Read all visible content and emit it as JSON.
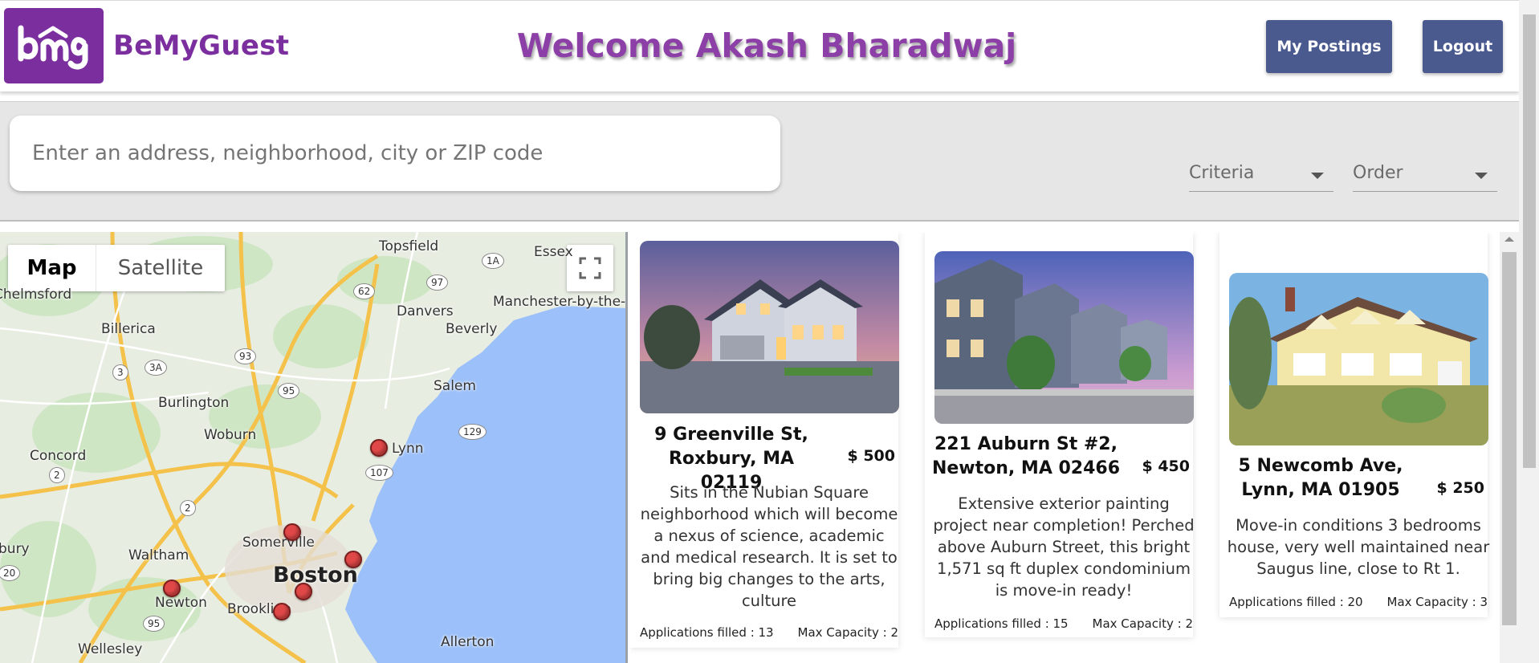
{
  "header": {
    "brand": "BeMyGuest",
    "welcome": "Welcome Akash Bharadwaj",
    "my_postings_label": "My Postings",
    "logout_label": "Logout",
    "brand_color": "#7b2f9f",
    "button_color": "#4a5a8f"
  },
  "search": {
    "placeholder": "Enter an address, neighborhood, city or ZIP code",
    "criteria_label": "Criteria",
    "order_label": "Order"
  },
  "map": {
    "type_map": "Map",
    "type_satellite": "Satellite",
    "labels": [
      "Topsfield",
      "Essex",
      "Chelmsford",
      "Danvers",
      "Manchester-by-the-Sea",
      "Billerica",
      "Beverly",
      "Salem",
      "Burlington",
      "Woburn",
      "Lynn",
      "Concord",
      "Somerville",
      "Waltham",
      "Boston",
      "Newton",
      "Brookline",
      "Wellesley",
      "Allerton",
      "bury"
    ],
    "route_shields": [
      "1A",
      "62",
      "97",
      "93",
      "3",
      "3A",
      "95",
      "129",
      "107",
      "2",
      "2",
      "20",
      "95"
    ]
  },
  "listings": [
    {
      "address": "9 Greenville St, Roxbury, MA 02119",
      "price": "$ 500",
      "description": "Sits in the Nubian Square neighborhood which will become a nexus of science, academic and medical research. It is set to bring big changes to the arts, culture",
      "applications": "Applications filled : 13",
      "capacity": "Max Capacity : 2"
    },
    {
      "address": "221 Auburn St #2, Newton, MA 02466",
      "price": "$ 450",
      "description": "Extensive exterior painting project near completion! Perched above Auburn Street, this bright 1,571 sq ft duplex condominium is move-in ready!",
      "applications": "Applications filled : 15",
      "capacity": "Max Capacity : 2"
    },
    {
      "address": "5 Newcomb Ave, Lynn, MA 01905",
      "price": "$ 250",
      "description": "Move-in conditions 3 bedrooms house, very well maintained near Saugus line, close to Rt 1.",
      "applications": "Applications filled : 20",
      "capacity": "Max Capacity : 3"
    }
  ]
}
